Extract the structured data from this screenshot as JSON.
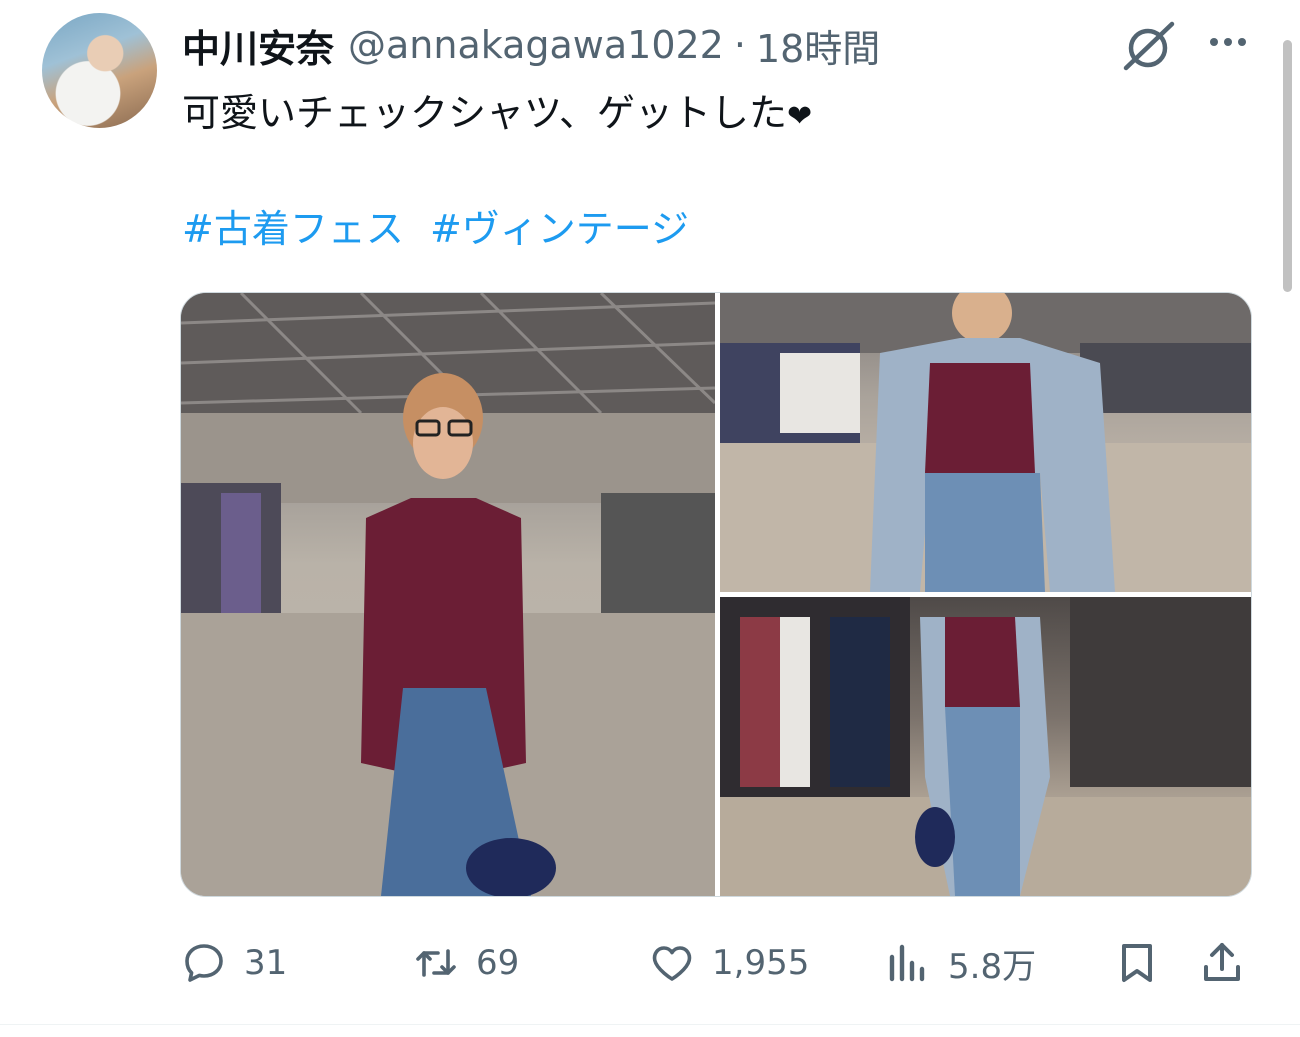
{
  "author": {
    "display_name": "中川安奈",
    "handle": "@annakagawa1022",
    "separator": "·",
    "time": "18時間"
  },
  "tweet": {
    "text": "可愛いチェックシャツ、ゲットした",
    "heart": "❤",
    "hashtags": [
      "#古着フェス",
      "#ヴィンテージ"
    ]
  },
  "media": {
    "count": 3,
    "photos": [
      "photo-1",
      "photo-2",
      "photo-3"
    ]
  },
  "actions": {
    "replies": "31",
    "reposts": "69",
    "likes": "1,955",
    "views": "5.8万"
  },
  "icons": {
    "grok": "grok-icon",
    "more": "more-icon",
    "reply": "reply-icon",
    "repost": "repost-icon",
    "like": "heart-icon",
    "views": "views-icon",
    "bookmark": "bookmark-icon",
    "share": "share-icon"
  },
  "colors": {
    "text": "#0f1419",
    "secondary": "#536471",
    "link": "#1d9bf0",
    "border": "#cfd9de"
  }
}
